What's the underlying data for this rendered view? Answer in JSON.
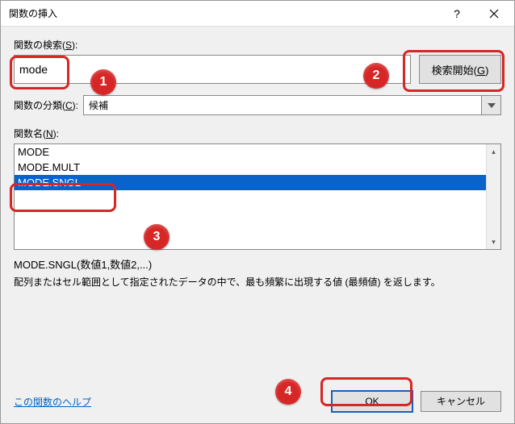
{
  "dialog": {
    "title": "関数の挿入"
  },
  "search": {
    "label_prefix": "関数の検索(",
    "label_key": "S",
    "label_suffix": "):",
    "value": "mode",
    "button_prefix": "検索開始(",
    "button_key": "G",
    "button_suffix": ")"
  },
  "category": {
    "label_prefix": "関数の分類(",
    "label_key": "C",
    "label_suffix": "):",
    "selected": "候補"
  },
  "functions": {
    "label_prefix": "関数名(",
    "label_key": "N",
    "label_suffix": "):",
    "items": [
      "MODE",
      "MODE.MULT",
      "MODE.SNGL"
    ],
    "selected_index": 2
  },
  "detail": {
    "syntax": "MODE.SNGL(数値1,数値2,...)",
    "description": "配列またはセル範囲として指定されたデータの中で、最も頻繁に出現する値 (最頻値) を返します。"
  },
  "footer": {
    "help_link": "この関数のヘルプ",
    "ok_label": "OK",
    "cancel_label": "キャンセル"
  },
  "annotations": [
    "1",
    "2",
    "3",
    "4"
  ]
}
